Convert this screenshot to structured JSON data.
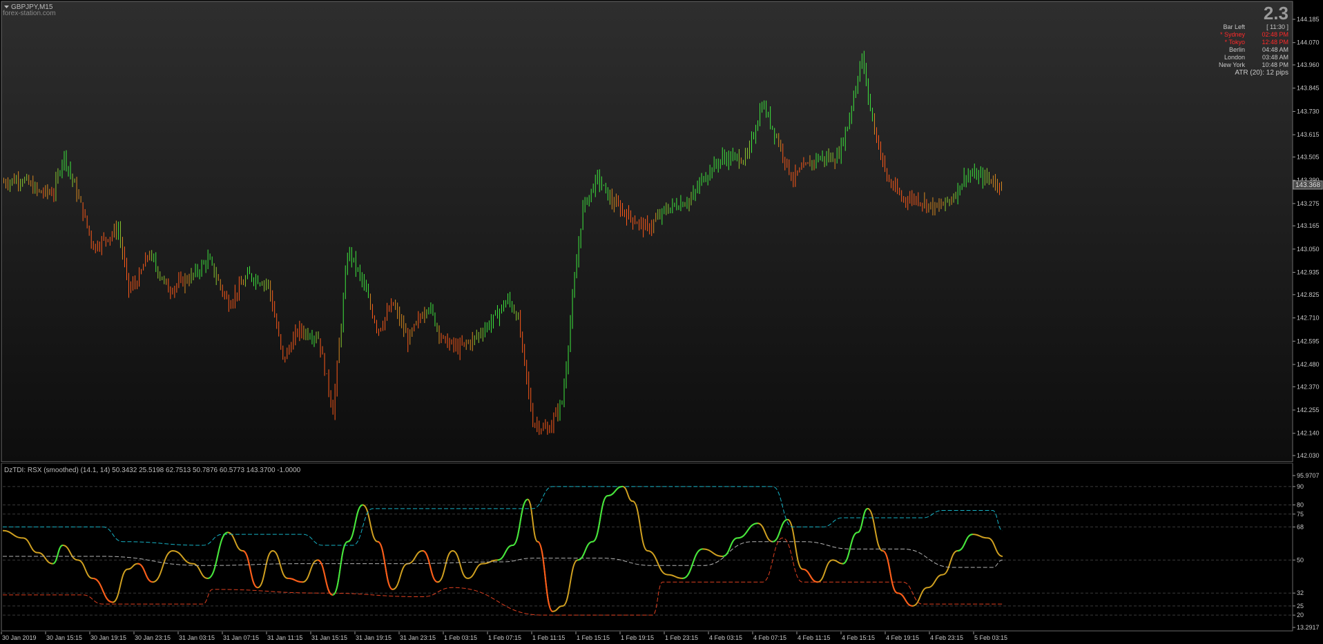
{
  "window": {
    "symbol": "GBPJPY,M15",
    "watermark": "forex-station.com",
    "current_price": "143.368"
  },
  "info_panel": {
    "spread": "2.3",
    "rows": [
      {
        "label": "Bar Left",
        "value": "[ 11:30 ]",
        "color": "#c8c8c8"
      },
      {
        "label": "* Sydney",
        "value": "02:48 PM",
        "color": "#ff2a2a"
      },
      {
        "label": "* Tokyo",
        "value": "12:48 PM",
        "color": "#ff2a2a"
      },
      {
        "label": "Berlin",
        "value": "04:48 AM",
        "color": "#c8c8c8"
      },
      {
        "label": "London",
        "value": "03:48 AM",
        "color": "#c8c8c8"
      },
      {
        "label": "New York",
        "value": "10:48 PM",
        "color": "#c8c8c8"
      }
    ],
    "atr": "ATR (20): 12 pips"
  },
  "price_axis": {
    "labels": [
      "144.185",
      "144.070",
      "143.960",
      "143.845",
      "143.730",
      "143.615",
      "143.505",
      "143.390",
      "143.275",
      "143.165",
      "143.050",
      "142.935",
      "142.825",
      "142.710",
      "142.595",
      "142.480",
      "142.370",
      "142.255",
      "142.140",
      "142.030"
    ]
  },
  "indicator": {
    "title": "DzTDI:  RSX (smoothed) (14.1, 14) 50.3432 25.5198 62.7513 50.7876 60.5773 143.3700 -1.0000",
    "axis_labels": [
      "95.9707",
      "90",
      "80",
      "75",
      "68",
      "50",
      "32",
      "25",
      "20",
      "13.2917"
    ],
    "levels": [
      90,
      80,
      75,
      68,
      50,
      32,
      25,
      20
    ]
  },
  "time_axis": {
    "labels": [
      "30 Jan 2019",
      "30 Jan 15:15",
      "30 Jan 19:15",
      "30 Jan 23:15",
      "31 Jan 03:15",
      "31 Jan 07:15",
      "31 Jan 11:15",
      "31 Jan 15:15",
      "31 Jan 19:15",
      "31 Jan 23:15",
      "1 Feb 03:15",
      "1 Feb 07:15",
      "1 Feb 11:15",
      "1 Feb 15:15",
      "1 Feb 19:15",
      "1 Feb 23:15",
      "4 Feb 03:15",
      "4 Feb 07:15",
      "4 Feb 11:15",
      "4 Feb 15:15",
      "4 Feb 19:15",
      "4 Feb 23:15",
      "5 Feb 03:15"
    ]
  },
  "chart_data": {
    "type": "candlestick",
    "price_range": [
      142.03,
      144.185
    ],
    "close_path": [
      {
        "t": 0.0,
        "p": 143.38
      },
      {
        "t": 0.018,
        "p": 143.4
      },
      {
        "t": 0.035,
        "p": 143.33
      },
      {
        "t": 0.05,
        "p": 143.33
      },
      {
        "t": 0.06,
        "p": 143.52
      },
      {
        "t": 0.075,
        "p": 143.3
      },
      {
        "t": 0.09,
        "p": 143.06
      },
      {
        "t": 0.115,
        "p": 143.15
      },
      {
        "t": 0.125,
        "p": 142.85
      },
      {
        "t": 0.135,
        "p": 142.9
      },
      {
        "t": 0.145,
        "p": 143.03
      },
      {
        "t": 0.165,
        "p": 142.85
      },
      {
        "t": 0.19,
        "p": 142.92
      },
      {
        "t": 0.205,
        "p": 143.0
      },
      {
        "t": 0.225,
        "p": 142.78
      },
      {
        "t": 0.245,
        "p": 142.92
      },
      {
        "t": 0.265,
        "p": 142.88
      },
      {
        "t": 0.28,
        "p": 142.5
      },
      {
        "t": 0.295,
        "p": 142.65
      },
      {
        "t": 0.315,
        "p": 142.62
      },
      {
        "t": 0.33,
        "p": 142.25
      },
      {
        "t": 0.345,
        "p": 143.05
      },
      {
        "t": 0.36,
        "p": 142.88
      },
      {
        "t": 0.375,
        "p": 142.65
      },
      {
        "t": 0.39,
        "p": 142.78
      },
      {
        "t": 0.405,
        "p": 142.6
      },
      {
        "t": 0.425,
        "p": 142.78
      },
      {
        "t": 0.44,
        "p": 142.6
      },
      {
        "t": 0.455,
        "p": 142.56
      },
      {
        "t": 0.47,
        "p": 142.6
      },
      {
        "t": 0.49,
        "p": 142.7
      },
      {
        "t": 0.505,
        "p": 142.8
      },
      {
        "t": 0.515,
        "p": 142.72
      },
      {
        "t": 0.53,
        "p": 142.2
      },
      {
        "t": 0.545,
        "p": 142.15
      },
      {
        "t": 0.56,
        "p": 142.3
      },
      {
        "t": 0.57,
        "p": 142.8
      },
      {
        "t": 0.58,
        "p": 143.25
      },
      {
        "t": 0.595,
        "p": 143.4
      },
      {
        "t": 0.61,
        "p": 143.28
      },
      {
        "t": 0.63,
        "p": 143.2
      },
      {
        "t": 0.645,
        "p": 143.15
      },
      {
        "t": 0.665,
        "p": 143.25
      },
      {
        "t": 0.69,
        "p": 143.3
      },
      {
        "t": 0.7,
        "p": 143.4
      },
      {
        "t": 0.72,
        "p": 143.5
      },
      {
        "t": 0.745,
        "p": 143.5
      },
      {
        "t": 0.76,
        "p": 143.77
      },
      {
        "t": 0.775,
        "p": 143.6
      },
      {
        "t": 0.79,
        "p": 143.4
      },
      {
        "t": 0.815,
        "p": 143.5
      },
      {
        "t": 0.835,
        "p": 143.5
      },
      {
        "t": 0.845,
        "p": 143.65
      },
      {
        "t": 0.86,
        "p": 144.0
      },
      {
        "t": 0.87,
        "p": 143.7
      },
      {
        "t": 0.885,
        "p": 143.4
      },
      {
        "t": 0.9,
        "p": 143.3
      },
      {
        "t": 0.915,
        "p": 143.3
      },
      {
        "t": 0.935,
        "p": 143.25
      },
      {
        "t": 0.95,
        "p": 143.3
      },
      {
        "t": 0.965,
        "p": 143.42
      },
      {
        "t": 0.985,
        "p": 143.4
      },
      {
        "t": 1.0,
        "p": 143.368
      }
    ],
    "indicator_series": [
      {
        "name": "RSX",
        "values": [
          [
            0,
            66
          ],
          [
            0.02,
            62
          ],
          [
            0.035,
            54
          ],
          [
            0.05,
            48
          ],
          [
            0.06,
            58
          ],
          [
            0.075,
            50
          ],
          [
            0.09,
            40
          ],
          [
            0.11,
            27
          ],
          [
            0.125,
            45
          ],
          [
            0.135,
            48
          ],
          [
            0.15,
            38
          ],
          [
            0.17,
            55
          ],
          [
            0.19,
            48
          ],
          [
            0.205,
            40
          ],
          [
            0.225,
            65
          ],
          [
            0.24,
            55
          ],
          [
            0.255,
            35
          ],
          [
            0.27,
            55
          ],
          [
            0.285,
            40
          ],
          [
            0.3,
            38
          ],
          [
            0.315,
            50
          ],
          [
            0.33,
            31
          ],
          [
            0.345,
            60
          ],
          [
            0.36,
            80
          ],
          [
            0.375,
            60
          ],
          [
            0.39,
            34
          ],
          [
            0.405,
            48
          ],
          [
            0.42,
            55
          ],
          [
            0.435,
            38
          ],
          [
            0.45,
            55
          ],
          [
            0.465,
            40
          ],
          [
            0.48,
            48
          ],
          [
            0.495,
            50
          ],
          [
            0.51,
            58
          ],
          [
            0.525,
            83
          ],
          [
            0.535,
            60
          ],
          [
            0.55,
            22
          ],
          [
            0.56,
            25
          ],
          [
            0.575,
            50
          ],
          [
            0.59,
            60
          ],
          [
            0.605,
            85
          ],
          [
            0.62,
            90
          ],
          [
            0.63,
            82
          ],
          [
            0.645,
            55
          ],
          [
            0.665,
            42
          ],
          [
            0.68,
            40
          ],
          [
            0.7,
            56
          ],
          [
            0.72,
            52
          ],
          [
            0.735,
            62
          ],
          [
            0.755,
            70
          ],
          [
            0.77,
            60
          ],
          [
            0.785,
            72
          ],
          [
            0.8,
            45
          ],
          [
            0.815,
            38
          ],
          [
            0.83,
            50
          ],
          [
            0.84,
            48
          ],
          [
            0.855,
            65
          ],
          [
            0.865,
            78
          ],
          [
            0.88,
            55
          ],
          [
            0.895,
            32
          ],
          [
            0.91,
            25
          ],
          [
            0.925,
            35
          ],
          [
            0.94,
            42
          ],
          [
            0.955,
            55
          ],
          [
            0.97,
            64
          ],
          [
            0.985,
            62
          ],
          [
            1.0,
            52
          ]
        ],
        "color": "#d0a020"
      },
      {
        "name": "Upper Band",
        "values": [
          [
            0,
            68
          ],
          [
            0.1,
            68
          ],
          [
            0.12,
            60
          ],
          [
            0.2,
            58
          ],
          [
            0.22,
            64
          ],
          [
            0.3,
            64
          ],
          [
            0.32,
            58
          ],
          [
            0.35,
            58
          ],
          [
            0.37,
            78
          ],
          [
            0.53,
            78
          ],
          [
            0.55,
            90
          ],
          [
            0.77,
            90
          ],
          [
            0.79,
            68
          ],
          [
            0.82,
            68
          ],
          [
            0.84,
            73
          ],
          [
            0.92,
            73
          ],
          [
            0.94,
            77
          ],
          [
            0.99,
            77
          ],
          [
            1.0,
            66
          ]
        ],
        "color": "#16b3c6"
      },
      {
        "name": "Middle",
        "values": [
          [
            0,
            52
          ],
          [
            0.1,
            52
          ],
          [
            0.2,
            47
          ],
          [
            0.3,
            48
          ],
          [
            0.4,
            48
          ],
          [
            0.5,
            49
          ],
          [
            0.53,
            51
          ],
          [
            0.6,
            51
          ],
          [
            0.65,
            47
          ],
          [
            0.7,
            47
          ],
          [
            0.75,
            60
          ],
          [
            0.8,
            60
          ],
          [
            0.85,
            56
          ],
          [
            0.9,
            56
          ],
          [
            0.95,
            46
          ],
          [
            0.99,
            46
          ],
          [
            1.0,
            50
          ]
        ],
        "color": "#b4b4b4"
      },
      {
        "name": "Lower Band",
        "values": [
          [
            0,
            31
          ],
          [
            0.08,
            31
          ],
          [
            0.1,
            26
          ],
          [
            0.2,
            26
          ],
          [
            0.21,
            34
          ],
          [
            0.32,
            32
          ],
          [
            0.42,
            30
          ],
          [
            0.45,
            35
          ],
          [
            0.54,
            20
          ],
          [
            0.65,
            20
          ],
          [
            0.66,
            38
          ],
          [
            0.76,
            38
          ],
          [
            0.78,
            62
          ],
          [
            0.8,
            38
          ],
          [
            0.9,
            38
          ],
          [
            0.92,
            26
          ],
          [
            1.0,
            26
          ]
        ],
        "color": "#e04020"
      }
    ]
  },
  "colors": {
    "bull": "#3ee83e",
    "mid": "#c8a020",
    "bear": "#ff5a1a",
    "grid": "#3a3a3a",
    "axis_text": "#c8c8c8"
  }
}
